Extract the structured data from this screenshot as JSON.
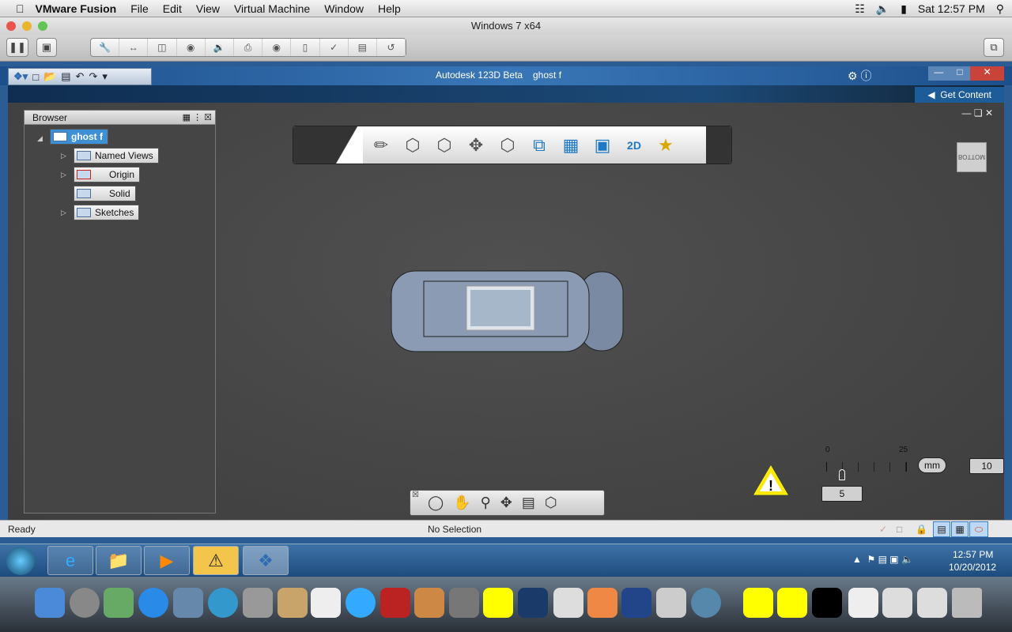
{
  "mac_menu": {
    "app": "VMware Fusion",
    "items": [
      "File",
      "Edit",
      "View",
      "Virtual Machine",
      "Window",
      "Help"
    ],
    "clock": "Sat 12:57 PM"
  },
  "vm": {
    "title": "Windows 7 x64",
    "toolbar_icons": [
      "wrench-icon",
      "network-icon",
      "disk-icon",
      "cd-icon",
      "sound-icon",
      "printer-icon",
      "camera-icon",
      "mouse-icon",
      "bluetooth-icon",
      "floppy-icon",
      "usb-icon"
    ]
  },
  "app": {
    "title": "Autodesk 123D Beta",
    "document": "ghost f",
    "get_content": "Get Content"
  },
  "browser": {
    "title": "Browser",
    "root": "ghost f",
    "items": [
      "Named Views",
      "Origin",
      "Solid",
      "Sketches"
    ]
  },
  "viewcube": {
    "face": "BOTTOM"
  },
  "scale": {
    "min": "0",
    "max": "25",
    "unit": "mm",
    "value": "5",
    "grid": "10"
  },
  "status": {
    "left": "Ready",
    "center": "No Selection"
  },
  "taskbar": {
    "time": "12:57 PM",
    "date": "10/20/2012"
  },
  "colors": {
    "accent": "#2b5c93",
    "viewport": "#464646",
    "model": "#8b9bb3"
  }
}
